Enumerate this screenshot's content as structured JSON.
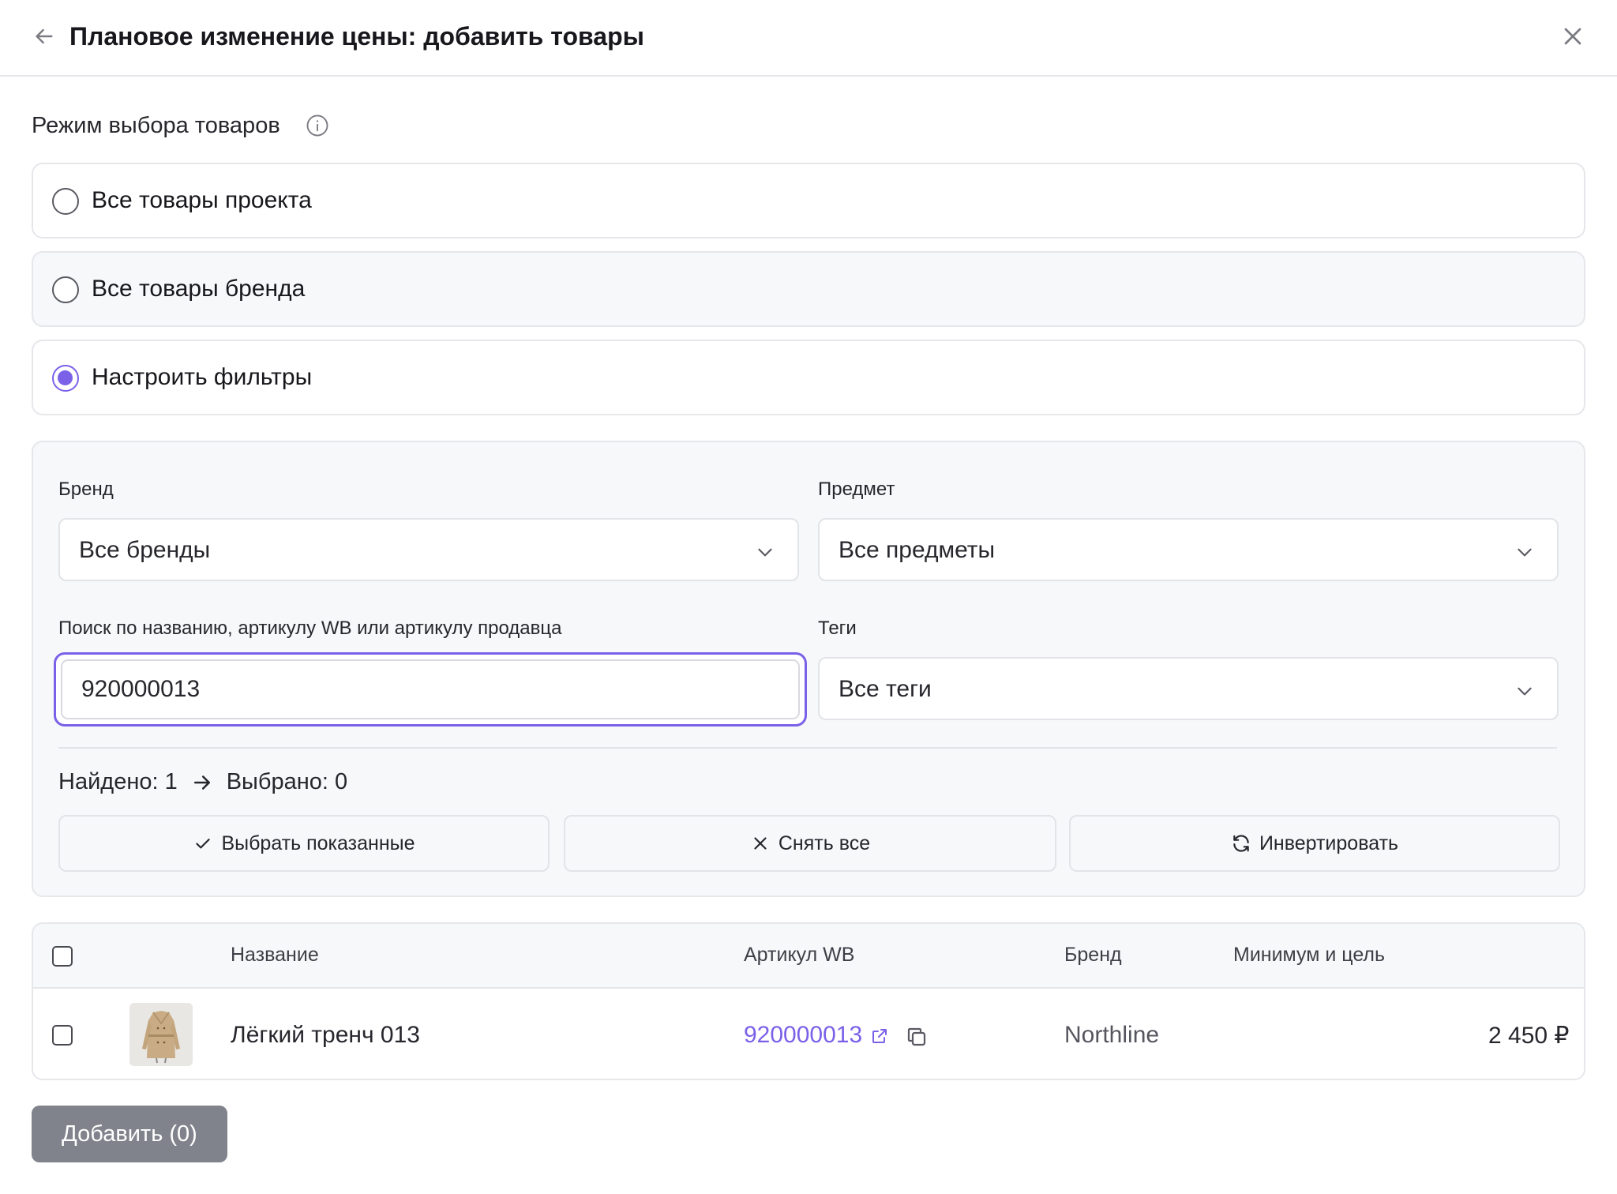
{
  "header": {
    "title": "Плановое изменение цены: добавить товары"
  },
  "mode": {
    "label": "Режим выбора товаров",
    "options": [
      {
        "label": "Все товары проекта",
        "selected": false
      },
      {
        "label": "Все товары бренда",
        "selected": false
      },
      {
        "label": "Настроить фильтры",
        "selected": true
      }
    ]
  },
  "filters": {
    "brand": {
      "label": "Бренд",
      "value": "Все бренды"
    },
    "subject": {
      "label": "Предмет",
      "value": "Все предметы"
    },
    "search": {
      "label": "Поиск по названию, артикулу WB или артикулу продавца",
      "value": "920000013"
    },
    "tags": {
      "label": "Теги",
      "value": "Все теги"
    }
  },
  "counter": {
    "found": "Найдено: 1",
    "selected": "Выбрано: 0"
  },
  "actions": {
    "select_shown": "Выбрать показанные",
    "clear_all": "Снять все",
    "invert": "Инвертировать"
  },
  "table": {
    "columns": {
      "name": "Название",
      "sku": "Артикул WB",
      "brand": "Бренд",
      "min_target": "Минимум и цель"
    },
    "rows": [
      {
        "name": "Лёгкий тренч 013",
        "sku": "920000013",
        "brand": "Northline",
        "price": "2 450 ₽",
        "checked": false
      }
    ]
  },
  "footer": {
    "add_label": "Добавить (0)"
  },
  "colors": {
    "accent": "#7b61e8",
    "add_button": "#80838c",
    "panel_bg": "#f7f8fa",
    "border": "#e6e7eb"
  },
  "icons": [
    "arrow-left-icon",
    "close-icon",
    "info-icon",
    "chevron-down-icon",
    "arrow-right-icon",
    "check-icon",
    "x-icon",
    "refresh-icon",
    "external-link-icon",
    "copy-icon"
  ]
}
